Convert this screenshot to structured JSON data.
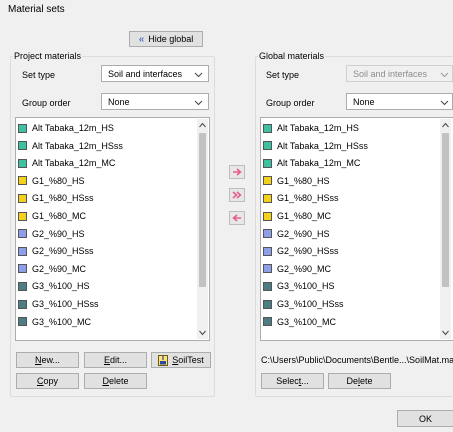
{
  "window_title": "Material sets",
  "hide_global_label": "Hide global",
  "project": {
    "title": "Project materials",
    "set_type_label": "Set type",
    "set_type_value": "Soil and interfaces",
    "group_order_label": "Group order",
    "group_order_value": "None",
    "items": [
      {
        "label": "Alt Tabaka_12m_HS",
        "color": "#3cc2a0"
      },
      {
        "label": "Alt Tabaka_12m_HSss",
        "color": "#3cc2a0"
      },
      {
        "label": "Alt Tabaka_12m_MC",
        "color": "#3cc2a0"
      },
      {
        "label": "G1_%80_HS",
        "color": "#f2d21b"
      },
      {
        "label": "G1_%80_HSss",
        "color": "#f2d21b"
      },
      {
        "label": "G1_%80_MC",
        "color": "#f2d21b"
      },
      {
        "label": "G2_%90_HS",
        "color": "#8e9ee8"
      },
      {
        "label": "G2_%90_HSss",
        "color": "#8e9ee8"
      },
      {
        "label": "G2_%90_MC",
        "color": "#8e9ee8"
      },
      {
        "label": "G3_%100_HS",
        "color": "#4d7c82"
      },
      {
        "label": "G3_%100_HSss",
        "color": "#4d7c82"
      },
      {
        "label": "G3_%100_MC",
        "color": "#4d7c82"
      }
    ],
    "buttons": {
      "new_mn": "N",
      "new_rest": "ew...",
      "edit_mn": "E",
      "edit_rest": "dit...",
      "soiltest_mn": "S",
      "soiltest_rest": "oilTest",
      "copy_mn": "C",
      "copy_rest": "opy",
      "delete_pre": "",
      "delete_mn": "D",
      "delete_rest": "elete"
    }
  },
  "global": {
    "title": "Global materials",
    "set_type_label": "Set type",
    "set_type_value": "Soil and interfaces",
    "group_order_label": "Group order",
    "group_order_value": "None",
    "items": [
      {
        "label": "Alt Tabaka_12m_HS",
        "color": "#3cc2a0"
      },
      {
        "label": "Alt Tabaka_12m_HSss",
        "color": "#3cc2a0"
      },
      {
        "label": "Alt Tabaka_12m_MC",
        "color": "#3cc2a0"
      },
      {
        "label": "G1_%80_HS",
        "color": "#f2d21b"
      },
      {
        "label": "G1_%80_HSss",
        "color": "#f2d21b"
      },
      {
        "label": "G1_%80_MC",
        "color": "#f2d21b"
      },
      {
        "label": "G2_%90_HS",
        "color": "#8e9ee8"
      },
      {
        "label": "G2_%90_HSss",
        "color": "#8e9ee8"
      },
      {
        "label": "G2_%90_MC",
        "color": "#8e9ee8"
      },
      {
        "label": "G3_%100_HS",
        "color": "#4d7c82"
      },
      {
        "label": "G3_%100_HSss",
        "color": "#4d7c82"
      },
      {
        "label": "G3_%100_MC",
        "color": "#4d7c82"
      }
    ],
    "path": "C:\\Users\\Public\\Documents\\Bentle...\\SoilMat.matdb",
    "buttons": {
      "select_pre": "Selec",
      "select_mn": "t",
      "select_rest": "...",
      "delete_pre": "De",
      "delete_mn": "l",
      "delete_rest": "ete"
    }
  },
  "ok_label": "OK",
  "colors": {
    "accent": "#e85a8a",
    "hide_global_arrow": "#5b79c9"
  }
}
